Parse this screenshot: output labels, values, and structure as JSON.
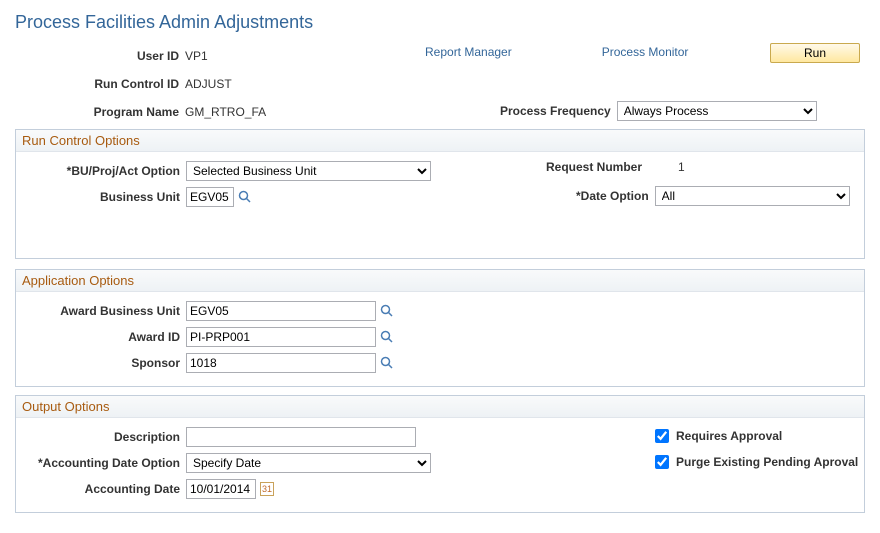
{
  "page": {
    "title": "Process Facilities Admin Adjustments"
  },
  "header": {
    "user_id_label": "User ID",
    "user_id": "VP1",
    "run_control_id_label": "Run Control ID",
    "run_control_id": "ADJUST",
    "program_name_label": "Program Name",
    "program_name": "GM_RTRO_FA",
    "report_manager": "Report Manager",
    "process_monitor": "Process Monitor",
    "run": "Run",
    "process_frequency_label": "Process Frequency",
    "process_frequency": "Always Process"
  },
  "run_control": {
    "title": "Run Control Options",
    "bu_proj_act_option_label": "*BU/Proj/Act Option",
    "bu_proj_act_option": "Selected Business Unit",
    "business_unit_label": "Business Unit",
    "business_unit": "EGV05",
    "request_number_label": "Request Number",
    "request_number": "1",
    "date_option_label": "*Date Option",
    "date_option": "All"
  },
  "app_options": {
    "title": "Application Options",
    "award_bu_label": "Award Business Unit",
    "award_bu": "EGV05",
    "award_id_label": "Award ID",
    "award_id": "PI-PRP001",
    "sponsor_label": "Sponsor",
    "sponsor": "1018"
  },
  "output_options": {
    "title": "Output Options",
    "description_label": "Description",
    "description": "",
    "acct_date_option_label": "*Accounting Date Option",
    "acct_date_option": "Specify Date",
    "acct_date_label": "Accounting Date",
    "acct_date": "10/01/2014",
    "requires_approval_label": "Requires Approval",
    "purge_label": "Purge Existing Pending Aproval"
  }
}
